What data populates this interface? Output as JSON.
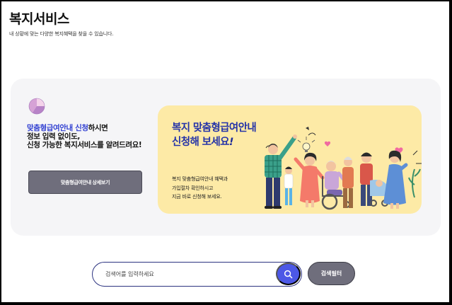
{
  "header": {
    "title": "복지서비스",
    "subtitle": "내 상황에 맞는 다양한 복지혜택을 찾을 수 있습니다."
  },
  "promo": {
    "highlight": "맞춤형급여안내 신청",
    "text_1": "하시면",
    "text_2": "정보 입력 없이도,",
    "text_3": "신청 가능한 복지서비스를 알려드려요!",
    "button_label": "맞춤형급여안내 상세보기"
  },
  "banner": {
    "title_line1": "복지 맞춤형급여안내",
    "title_line2": "신청해 보세요",
    "title_mark": "!",
    "desc_line1": "복지 맞춤형급여안내 혜택과",
    "desc_line2": "가입절차 확인하시고",
    "desc_line3": "지금 바로 신청해 보세요."
  },
  "search": {
    "placeholder": "검색어를 입력하세요",
    "filter_label": "검색필터"
  },
  "icons": {
    "pie": "pie-chart-icon",
    "search": "search-icon"
  },
  "colors": {
    "accent": "#2f3ed1",
    "banner_bg": "#fdeaa6",
    "button_gray": "#6f6e7c",
    "search_blue": "#4c58e6"
  }
}
